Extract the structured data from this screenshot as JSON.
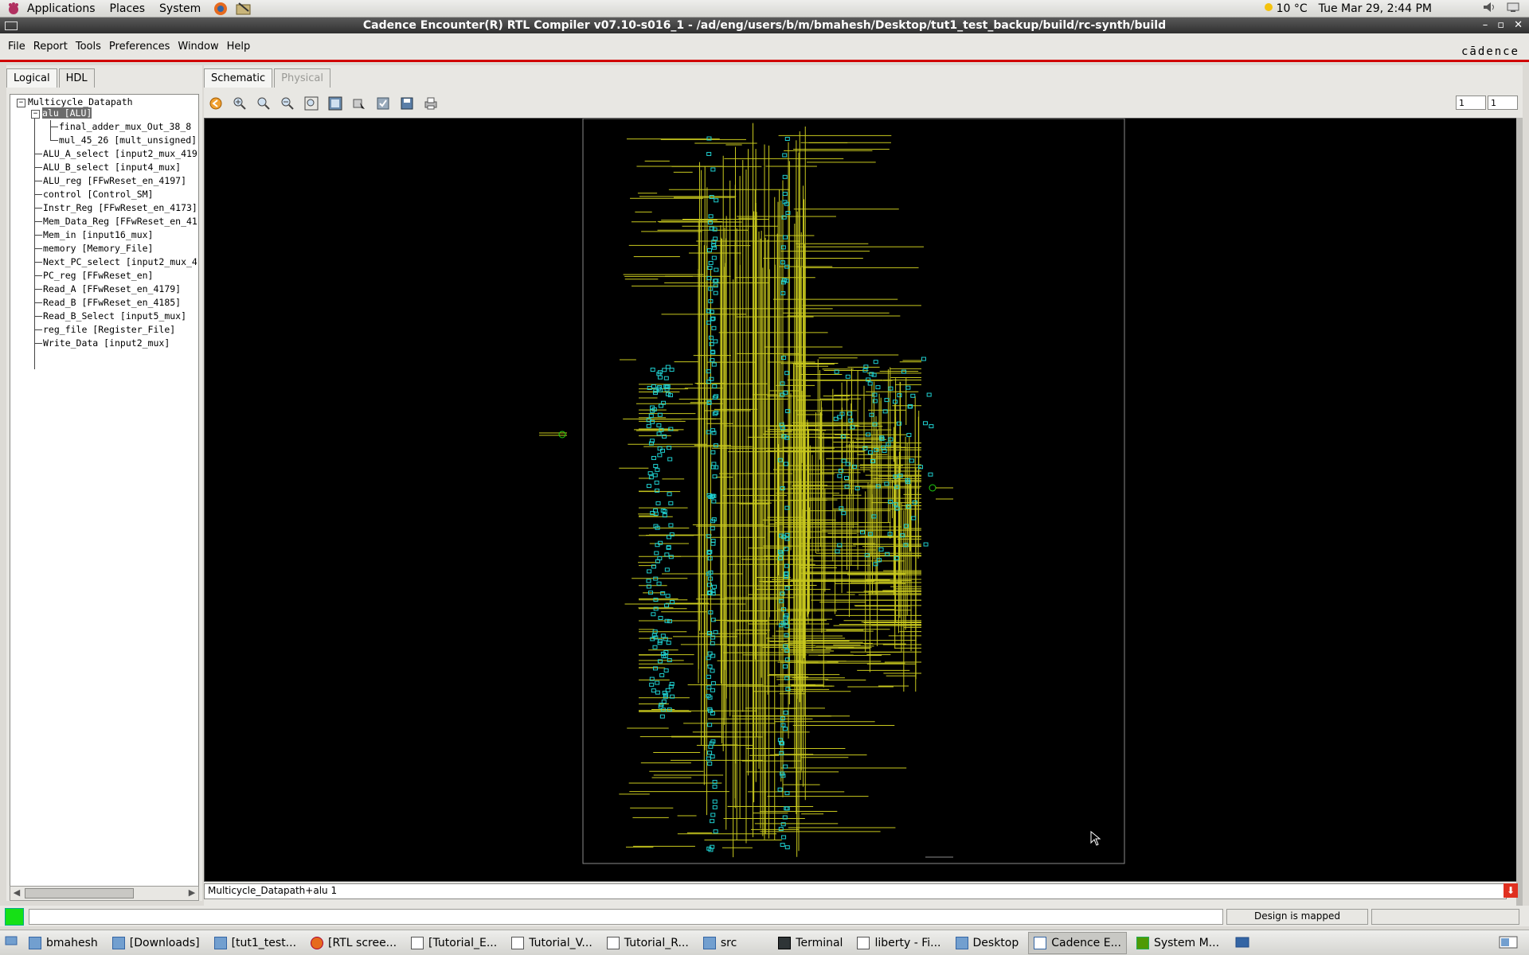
{
  "top_panel": {
    "menus": [
      "Applications",
      "Places",
      "System"
    ],
    "weather": "10 °C",
    "datetime": "Tue Mar 29,  2:44 PM"
  },
  "window": {
    "title": "Cadence Encounter(R) RTL Compiler v07.10-s016_1 - /ad/eng/users/b/m/bmahesh/Desktop/tut1_test_backup/build/rc-synth/build"
  },
  "menubar": {
    "items": [
      "File",
      "Report",
      "Tools",
      "Preferences",
      "Window",
      "Help"
    ],
    "logo": "cādence"
  },
  "left_panel": {
    "tabs": [
      "Logical",
      "HDL"
    ],
    "tree": {
      "root": "Multicycle_Datapath",
      "selected": "alu [ALU]",
      "alu_children": [
        "final_adder_mux_Out_38_8",
        "mul_45_26 [mult_unsigned]"
      ],
      "items": [
        "ALU_A_select [input2_mux_419",
        "ALU_B_select [input4_mux]",
        "ALU_reg [FFwReset_en_4197]",
        "control [Control_SM]",
        "Instr_Reg [FFwReset_en_4173]",
        "Mem_Data_Reg [FFwReset_en_41",
        "Mem_in [input16_mux]",
        "memory [Memory_File]",
        "Next_PC_select [input2_mux_4",
        "PC_reg [FFwReset_en]",
        "Read_A [FFwReset_en_4179]",
        "Read_B [FFwReset_en_4185]",
        "Read_B_Select [input5_mux]",
        "reg_file [Register_File]",
        "Write_Data [input2_mux]"
      ]
    }
  },
  "right_panel": {
    "tabs": [
      "Schematic",
      "Physical"
    ],
    "page_from": "1",
    "page_to": "1",
    "path": "Multicycle_Datapath+alu 1"
  },
  "status": {
    "message": "Design is mapped"
  },
  "taskbar": {
    "items": [
      "bmahesh",
      "[Downloads]",
      "[tut1_test...",
      "[RTL scree...",
      "[Tutorial_E...",
      "Tutorial_V...",
      "Tutorial_R...",
      "src",
      "Terminal",
      "liberty - Fi...",
      "Desktop",
      "Cadence E...",
      "System M..."
    ]
  }
}
